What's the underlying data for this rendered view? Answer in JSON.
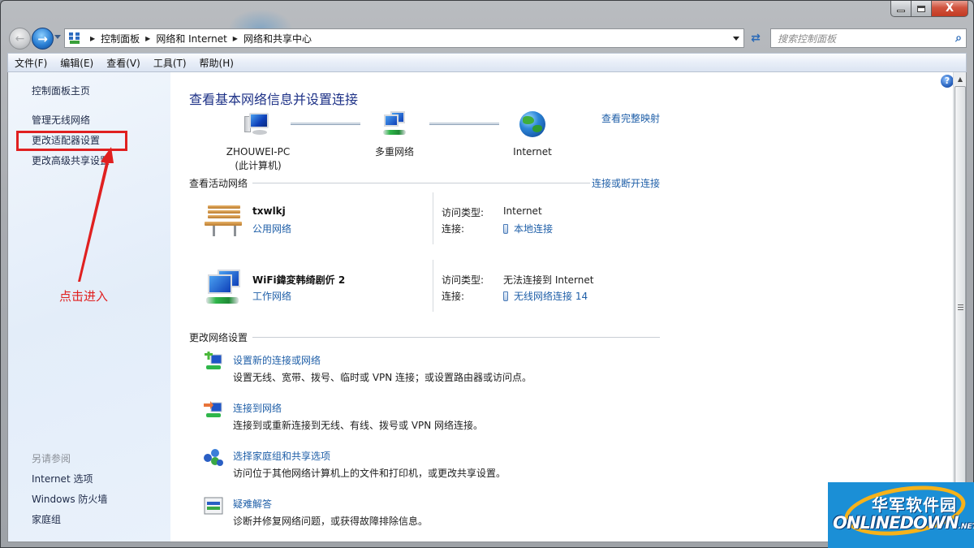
{
  "window": {
    "controls": {
      "minimize_icon": "minimize-icon",
      "maximize_icon": "maximize-icon",
      "close_label": "X"
    }
  },
  "nav": {
    "back_icon": "back-arrow-icon",
    "forward_icon": "forward-arrow-icon",
    "breadcrumb": [
      "控制面板",
      "网络和 Internet",
      "网络和共享中心"
    ],
    "search_placeholder": "搜索控制面板"
  },
  "menubar": {
    "items": [
      "文件(F)",
      "编辑(E)",
      "查看(V)",
      "工具(T)",
      "帮助(H)"
    ]
  },
  "sidebar": {
    "home_link": "控制面板主页",
    "links": [
      "管理无线网络",
      "更改适配器设置",
      "更改高级共享设置"
    ],
    "see_also_heading": "另请参阅",
    "see_also": [
      "Internet 选项",
      "Windows 防火墙",
      "家庭组"
    ]
  },
  "annotation": {
    "text": "点击进入",
    "color": "#e02020",
    "target": "更改适配器设置"
  },
  "main": {
    "title": "查看基本网络信息并设置连接",
    "full_map_link": "查看完整映射",
    "map_nodes": [
      {
        "name": "ZHOUWEI-PC",
        "sub": "(此计算机)"
      },
      {
        "name": "多重网络",
        "sub": ""
      },
      {
        "name": "Internet",
        "sub": ""
      }
    ],
    "active_networks": {
      "heading": "查看活动网络",
      "action_link": "连接或断开连接",
      "networks": [
        {
          "name": "txwlkj",
          "type": "公用网络",
          "access_label": "访问类型:",
          "access_value": "Internet",
          "connection_label": "连接:",
          "connection_value": "本地连接"
        },
        {
          "name": "WiFi鍏変韩绮剧伒  2",
          "type": "工作网络",
          "access_label": "访问类型:",
          "access_value": "无法连接到 Internet",
          "connection_label": "连接:",
          "connection_value": "无线网络连接 14"
        }
      ]
    },
    "change_settings": {
      "heading": "更改网络设置",
      "tasks": [
        {
          "link": "设置新的连接或网络",
          "desc": "设置无线、宽带、拨号、临时或 VPN 连接；或设置路由器或访问点。"
        },
        {
          "link": "连接到网络",
          "desc": "连接到或重新连接到无线、有线、拨号或 VPN 网络连接。"
        },
        {
          "link": "选择家庭组和共享选项",
          "desc": "访问位于其他网络计算机上的文件和打印机，或更改共享设置。"
        },
        {
          "link": "疑难解答",
          "desc": "诊断并修复网络问题，或获得故障排除信息。"
        }
      ]
    },
    "help_label": "?"
  },
  "watermark": {
    "cn": "华军软件园",
    "en": "ONLINEDOWN",
    "tld": ".NET"
  },
  "colors": {
    "link": "#1f5fa8",
    "title": "#1e3287",
    "annotation": "#e02020"
  }
}
